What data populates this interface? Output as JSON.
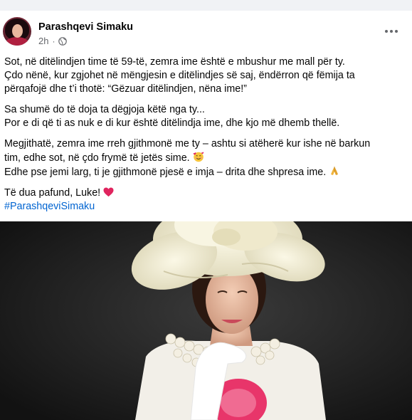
{
  "post": {
    "author": "Parashqevi Simaku",
    "time": "2h",
    "separator": "·",
    "paragraphs": [
      {
        "lines": [
          "Sot, në ditëlindjen time të 59-të, zemra ime është e mbushur me mall për ty.",
          "Çdo nënë, kur zgjohet në mëngjesin e ditëlindjes së saj, ëndërron që fëmija ta",
          "përqafojë dhe t’i thotë: “Gëzuar ditëlindjen, nëna ime!”"
        ]
      },
      {
        "lines": [
          "Sa shumë do të doja ta dëgjoja këtë nga ty...",
          "Por e di që ti as nuk e di kur është ditëlindja ime, dhe kjo më dhemb thellë."
        ]
      },
      {
        "lines": [
          "Megjithatë, zemra ime rreh gjithmonë me ty – ashtu si atëherë kur ishe në barkun",
          "tim, edhe sot, në çdo frymë të jetës sime.",
          "Edhe pse jemi larg, ti je gjithmonë pjesë e imja – drita dhe shpresa ime."
        ]
      },
      {
        "lines": [
          "Të dua pafund, Luke!"
        ]
      }
    ],
    "hashtag": "#ParashqeviSimaku"
  },
  "icons": {
    "globe": "globe-icon",
    "more": "more-options-icon",
    "emoji_hearts": "smiling-face-with-hearts-icon",
    "emoji_pray": "folded-hands-icon",
    "emoji_heart": "red-heart-icon"
  },
  "colors": {
    "hashtag": "#0064d1",
    "text": "#050505",
    "meta": "#65676b",
    "photo_bg": "#1b1b1b"
  }
}
